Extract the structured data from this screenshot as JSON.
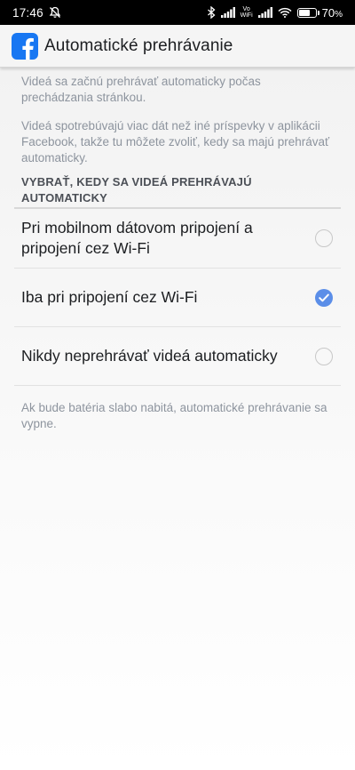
{
  "status_bar": {
    "time": "17:46",
    "volte_top": "Vo",
    "volte_bottom": "WiFi",
    "battery_percent": "70",
    "battery_unit": "%",
    "battery_level": 0.7,
    "icons": [
      "bell-off-icon",
      "bluetooth-icon",
      "signal-icon",
      "volte-wifi-icon",
      "signal-icon",
      "wifi-icon",
      "battery-icon"
    ]
  },
  "app_bar": {
    "title": "Automatické prehrávanie",
    "logo_letter": "f",
    "brand_color": "#1877f2"
  },
  "description": {
    "paragraph1": "Videá sa začnú prehrávať automaticky počas prechádzania stránkou.",
    "paragraph2": "Videá spotrebúvajú viac dát než iné príspevky v aplikácii Facebook, takže tu môžete zvoliť, kedy sa majú prehrávať automaticky."
  },
  "section": {
    "header": "VYBRAŤ, KEDY SA VIDEÁ PREHRÁVAJÚ AUTOMATICKY"
  },
  "options": [
    {
      "label": "Pri mobilnom dátovom pripojení a pripojení cez Wi-Fi",
      "selected": false
    },
    {
      "label": "Iba pri pripojení cez Wi-Fi",
      "selected": true
    },
    {
      "label": "Nikdy neprehrávať videá automaticky",
      "selected": false
    }
  ],
  "footer_note": "Ak bude batéria slabo nabitá, automatické prehrávanie sa vypne.",
  "colors": {
    "accent": "#5b8ee8",
    "secondary_text": "#8d949e"
  }
}
